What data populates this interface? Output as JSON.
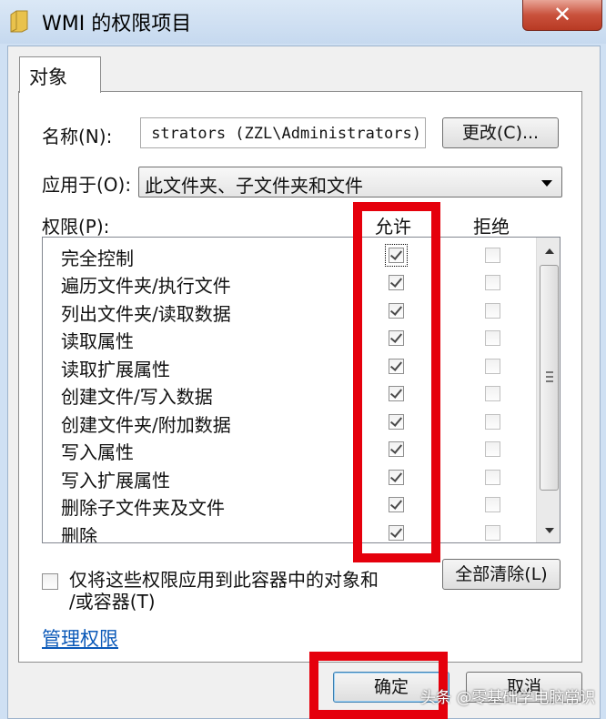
{
  "window": {
    "title": "WMI 的权限项目",
    "close_symbol": "✕"
  },
  "tab": {
    "label": "对象"
  },
  "name_row": {
    "label": "名称(N):",
    "value": "strators (ZZL\\Administrators)",
    "change_button": "更改(C)..."
  },
  "apply_to": {
    "label": "应用于(O):",
    "selected": "此文件夹、子文件夹和文件"
  },
  "permissions": {
    "label": "权限(P):",
    "allow_header": "允许",
    "deny_header": "拒绝",
    "items": [
      {
        "name": "完全控制",
        "allow": true,
        "deny": false
      },
      {
        "name": "遍历文件夹/执行文件",
        "allow": true,
        "deny": false
      },
      {
        "name": "列出文件夹/读取数据",
        "allow": true,
        "deny": false
      },
      {
        "name": "读取属性",
        "allow": true,
        "deny": false
      },
      {
        "name": "读取扩展属性",
        "allow": true,
        "deny": false
      },
      {
        "name": "创建文件/写入数据",
        "allow": true,
        "deny": false
      },
      {
        "name": "创建文件夹/附加数据",
        "allow": true,
        "deny": false
      },
      {
        "name": "写入属性",
        "allow": true,
        "deny": false
      },
      {
        "name": "写入扩展属性",
        "allow": true,
        "deny": false
      },
      {
        "name": "删除子文件夹及文件",
        "allow": true,
        "deny": false
      },
      {
        "name": "删除",
        "allow": true,
        "deny": false
      }
    ]
  },
  "apply_only": {
    "line1": "仅将这些权限应用到此容器中的对象和",
    "line2": "/或容器(T)",
    "checked": false
  },
  "clear_all_button": "全部清除(L)",
  "manage_link": "管理权限",
  "ok_button": "确定",
  "cancel_button": "取消",
  "watermark": "头条 @零基础学电脑常识",
  "colors": {
    "highlight": "#e5000c",
    "link": "#0b59b8",
    "close": "#c9513c"
  }
}
